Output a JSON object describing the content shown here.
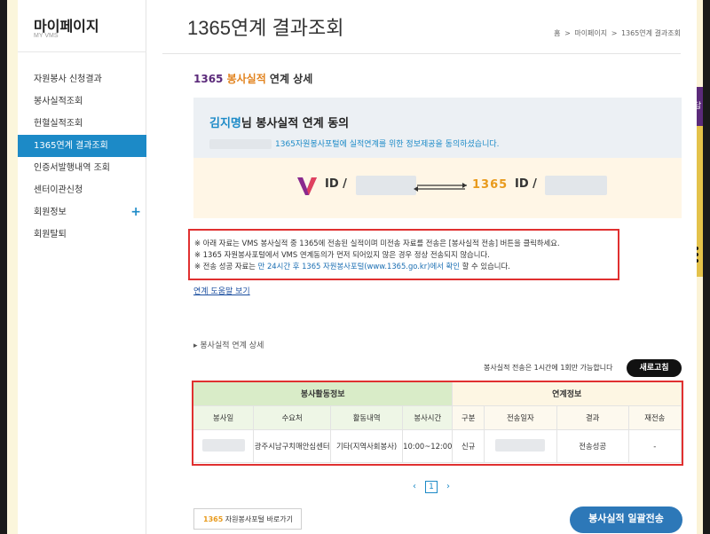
{
  "sidebar": {
    "title": "마이페이지",
    "subtitle": "MY VMS",
    "items": [
      {
        "label": "자원봉사 신청결과"
      },
      {
        "label": "봉사실적조회"
      },
      {
        "label": "헌혈실적조회"
      },
      {
        "label": "1365연계 결과조회"
      },
      {
        "label": "인증서발행내역 조회"
      },
      {
        "label": "센터이관신청"
      },
      {
        "label": "회원정보"
      },
      {
        "label": "회원탈퇴"
      }
    ],
    "plus": "+"
  },
  "header": {
    "title": "1365연계 결과조회",
    "breadcrumb": [
      "홈",
      ">",
      "마이페이지",
      ">",
      "1365연계 결과조회"
    ]
  },
  "section": {
    "title_part1": "1365",
    "title_part2": " 봉사실적",
    "title_part3": " 연계 상세"
  },
  "consent": {
    "name": "김지명",
    "name_suffix": "님 봉사실적 연계 동의",
    "message": "1365자원봉사포털에 실적연계를 위한 정보제공을 동의하셨습니다.",
    "id_label_left": "ID /",
    "id_label_right": "ID /",
    "logo_1365": "1365"
  },
  "notice": {
    "line1": "※ 아래 자료는 VMS 봉사실적 중 1365에 전송된 실적이며 미전송 자료를 전송은 [봉사실적 전송] 버튼을 클릭하세요.",
    "line2": "※ 1365 자원봉사포털에서 VMS 연계동의가 먼저 되어있지 않은 경우 정상 전송되지 않습니다.",
    "line3_a": "※ 전송 성공 자료는 ",
    "line3_b": "만 24시간 후 1365 자원봉사포털(www.1365.go.kr)에서 확인",
    "line3_c": " 할 수 있습니다."
  },
  "help_link": "연계 도움말 보기",
  "detail": {
    "subhead": "봉사실적 연계 상세",
    "limit_note": "봉사실적 전송은 1시간에 1회만 가능합니다",
    "refresh": "새로고침"
  },
  "table": {
    "group1": "봉사활동정보",
    "group2": "연계정보",
    "headers": [
      "봉사일",
      "수요처",
      "활동내역",
      "봉사시간",
      "구분",
      "전송일자",
      "결과",
      "재전송"
    ],
    "rows": [
      [
        "",
        "광주시남구치매안심센터",
        "기타(지역사회봉사)",
        "10:00~12:00",
        "신규",
        "",
        "전송성공",
        "-"
      ]
    ]
  },
  "pager": {
    "prev": "‹",
    "current": "1",
    "next": "›"
  },
  "footer": {
    "portal_logo": "1365",
    "portal_text": " 자원봉사포털 바로가기",
    "bulk_send": "봉사실적 일괄전송"
  },
  "right_tab": "답"
}
